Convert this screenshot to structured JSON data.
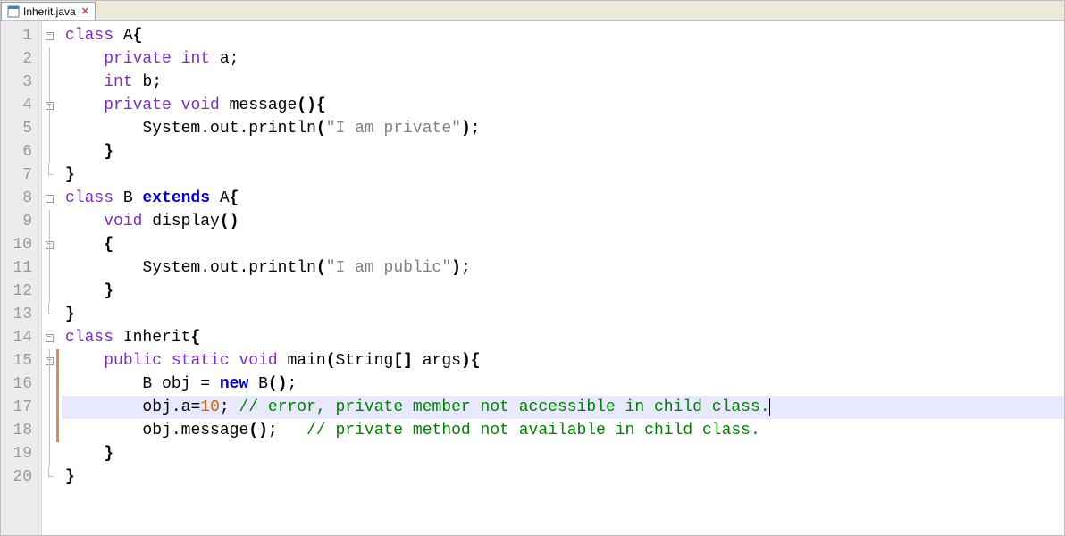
{
  "tab": {
    "filename": "Inherit.java",
    "close_glyph": "✕"
  },
  "gutter": {
    "line_count": 20
  },
  "fold": {
    "markers": {
      "1": "open",
      "2": "line",
      "3": "line",
      "4": "open-nested",
      "5": "line",
      "6": "line",
      "7": "end",
      "8": "open",
      "9": "line",
      "10": "open-nested",
      "11": "line",
      "12": "line",
      "13": "end",
      "14": "open",
      "15": "open-nested",
      "16": "line",
      "17": "line",
      "18": "line",
      "19": "line",
      "20": "end"
    }
  },
  "modified_lines": [
    15,
    16,
    17,
    18
  ],
  "current_line": 17,
  "code": {
    "l1": {
      "indent": "",
      "tokens": [
        {
          "t": "class ",
          "c": "mod-kw"
        },
        {
          "t": "A",
          "c": "ident"
        },
        {
          "t": "{",
          "c": "brace"
        }
      ]
    },
    "l2": {
      "indent": "    ",
      "tokens": [
        {
          "t": "private ",
          "c": "mod-kw"
        },
        {
          "t": "int ",
          "c": "type"
        },
        {
          "t": "a",
          "c": "ident"
        },
        {
          "t": ";",
          "c": "punct"
        }
      ]
    },
    "l3": {
      "indent": "    ",
      "tokens": [
        {
          "t": "int ",
          "c": "type"
        },
        {
          "t": "b",
          "c": "ident"
        },
        {
          "t": ";",
          "c": "punct"
        }
      ]
    },
    "l4": {
      "indent": "    ",
      "tokens": [
        {
          "t": "private ",
          "c": "mod-kw"
        },
        {
          "t": "void ",
          "c": "type"
        },
        {
          "t": "message",
          "c": "method"
        },
        {
          "t": "()",
          "c": "brace"
        },
        {
          "t": "{",
          "c": "brace"
        }
      ]
    },
    "l5": {
      "indent": "        ",
      "tokens": [
        {
          "t": "System",
          "c": "ident"
        },
        {
          "t": ".",
          "c": "punct"
        },
        {
          "t": "out",
          "c": "ident"
        },
        {
          "t": ".",
          "c": "punct"
        },
        {
          "t": "println",
          "c": "method"
        },
        {
          "t": "(",
          "c": "brace"
        },
        {
          "t": "\"I am private\"",
          "c": "str"
        },
        {
          "t": ")",
          "c": "brace"
        },
        {
          "t": ";",
          "c": "punct"
        }
      ]
    },
    "l6": {
      "indent": "    ",
      "tokens": [
        {
          "t": "}",
          "c": "brace"
        }
      ]
    },
    "l7": {
      "indent": "",
      "tokens": [
        {
          "t": "}",
          "c": "brace"
        }
      ]
    },
    "l8": {
      "indent": "",
      "tokens": [
        {
          "t": "class ",
          "c": "mod-kw"
        },
        {
          "t": "B ",
          "c": "ident"
        },
        {
          "t": "extends ",
          "c": "kw"
        },
        {
          "t": "A",
          "c": "ident"
        },
        {
          "t": "{",
          "c": "brace"
        }
      ]
    },
    "l9": {
      "indent": "    ",
      "tokens": [
        {
          "t": "void ",
          "c": "type"
        },
        {
          "t": "display",
          "c": "method"
        },
        {
          "t": "()",
          "c": "brace"
        }
      ]
    },
    "l10": {
      "indent": "    ",
      "tokens": [
        {
          "t": "{",
          "c": "brace"
        }
      ]
    },
    "l11": {
      "indent": "        ",
      "tokens": [
        {
          "t": "System",
          "c": "ident"
        },
        {
          "t": ".",
          "c": "punct"
        },
        {
          "t": "out",
          "c": "ident"
        },
        {
          "t": ".",
          "c": "punct"
        },
        {
          "t": "println",
          "c": "method"
        },
        {
          "t": "(",
          "c": "brace"
        },
        {
          "t": "\"I am public\"",
          "c": "str"
        },
        {
          "t": ")",
          "c": "brace"
        },
        {
          "t": ";",
          "c": "punct"
        }
      ]
    },
    "l12": {
      "indent": "    ",
      "tokens": [
        {
          "t": "}",
          "c": "brace"
        }
      ]
    },
    "l13": {
      "indent": "",
      "tokens": [
        {
          "t": "}",
          "c": "brace"
        }
      ]
    },
    "l14": {
      "indent": "",
      "tokens": [
        {
          "t": "class ",
          "c": "mod-kw"
        },
        {
          "t": "Inherit",
          "c": "ident"
        },
        {
          "t": "{",
          "c": "brace"
        }
      ]
    },
    "l15": {
      "indent": "    ",
      "tokens": [
        {
          "t": "public ",
          "c": "mod-kw"
        },
        {
          "t": "static ",
          "c": "mod-kw"
        },
        {
          "t": "void ",
          "c": "type"
        },
        {
          "t": "main",
          "c": "method"
        },
        {
          "t": "(",
          "c": "brace"
        },
        {
          "t": "String",
          "c": "ident"
        },
        {
          "t": "[] ",
          "c": "brace"
        },
        {
          "t": "args",
          "c": "ident"
        },
        {
          "t": ")",
          "c": "brace"
        },
        {
          "t": "{",
          "c": "brace"
        }
      ]
    },
    "l16": {
      "indent": "        ",
      "tokens": [
        {
          "t": "B obj ",
          "c": "ident"
        },
        {
          "t": "= ",
          "c": "punct"
        },
        {
          "t": "new ",
          "c": "kw"
        },
        {
          "t": "B",
          "c": "ident"
        },
        {
          "t": "()",
          "c": "brace"
        },
        {
          "t": ";",
          "c": "punct"
        }
      ]
    },
    "l17": {
      "indent": "        ",
      "tokens": [
        {
          "t": "obj",
          "c": "ident"
        },
        {
          "t": ".",
          "c": "punct"
        },
        {
          "t": "a",
          "c": "ident"
        },
        {
          "t": "=",
          "c": "punct"
        },
        {
          "t": "10",
          "c": "num"
        },
        {
          "t": "; ",
          "c": "punct"
        },
        {
          "t": "// error, private member not accessible in child class.",
          "c": "com"
        }
      ]
    },
    "l18": {
      "indent": "        ",
      "tokens": [
        {
          "t": "obj",
          "c": "ident"
        },
        {
          "t": ".",
          "c": "punct"
        },
        {
          "t": "message",
          "c": "method"
        },
        {
          "t": "()",
          "c": "brace"
        },
        {
          "t": ";   ",
          "c": "punct"
        },
        {
          "t": "// private method not available in child class.",
          "c": "com"
        }
      ]
    },
    "l19": {
      "indent": "    ",
      "tokens": [
        {
          "t": "}",
          "c": "brace"
        }
      ]
    },
    "l20": {
      "indent": "",
      "tokens": [
        {
          "t": "}",
          "c": "brace"
        }
      ]
    }
  }
}
